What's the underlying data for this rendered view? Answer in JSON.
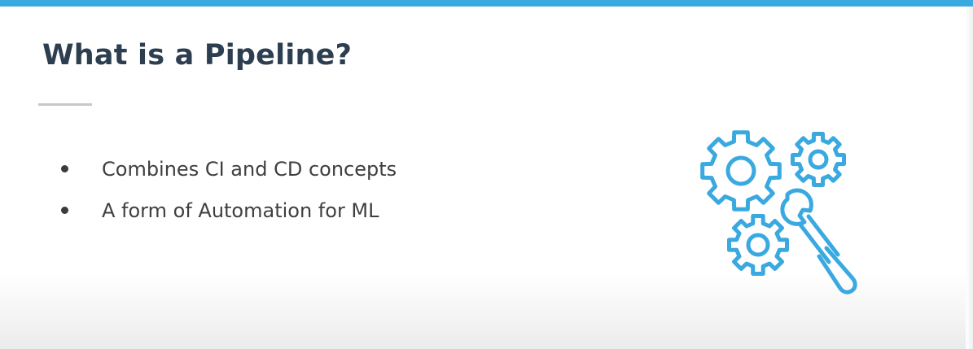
{
  "slide": {
    "title": "What is a Pipeline?",
    "bullets": [
      "Combines CI and CD concepts",
      "A form of Automation for ML"
    ],
    "illustration": {
      "icons": [
        "gear-icon",
        "gear-icon",
        "gear-icon",
        "wrench-icon"
      ],
      "color": "#3aa9e0"
    }
  },
  "theme": {
    "accent": "#3aa9e0",
    "title_color": "#2c3e50",
    "text_color": "#3f3f3f"
  }
}
